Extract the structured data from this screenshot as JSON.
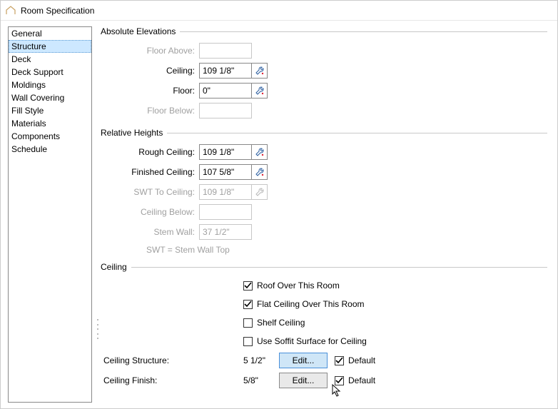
{
  "window": {
    "title": "Room Specification"
  },
  "nav": {
    "items": [
      "General",
      "Structure",
      "Deck",
      "Deck Support",
      "Moldings",
      "Wall Covering",
      "Fill Style",
      "Materials",
      "Components",
      "Schedule"
    ],
    "selected": 1
  },
  "groups": {
    "absolute": {
      "legend": "Absolute Elevations",
      "floor_above_label": "Floor Above:",
      "floor_above_value": "",
      "ceiling_label": "Ceiling:",
      "ceiling_value": "109 1/8\"",
      "floor_label": "Floor:",
      "floor_value": "0\"",
      "floor_below_label": "Floor Below:",
      "floor_below_value": ""
    },
    "relative": {
      "legend": "Relative Heights",
      "rough_ceiling_label": "Rough Ceiling:",
      "rough_ceiling_value": "109 1/8\"",
      "finished_ceiling_label": "Finished Ceiling:",
      "finished_ceiling_value": "107 5/8\"",
      "swt_to_ceiling_label": "SWT To Ceiling:",
      "swt_to_ceiling_value": "109 1/8\"",
      "ceiling_below_label": "Ceiling Below:",
      "ceiling_below_value": "",
      "stem_wall_label": "Stem Wall:",
      "stem_wall_value": "37 1/2\"",
      "note": "SWT = Stem Wall Top"
    },
    "ceiling": {
      "legend": "Ceiling",
      "roof_over_label": "Roof Over This Room",
      "roof_over_checked": true,
      "flat_ceiling_label": "Flat Ceiling Over This Room",
      "flat_ceiling_checked": true,
      "shelf_ceiling_label": "Shelf Ceiling",
      "shelf_ceiling_checked": false,
      "soffit_label": "Use Soffit Surface for Ceiling",
      "soffit_checked": false,
      "structure_label": "Ceiling Structure:",
      "structure_value": "5 1/2\"",
      "structure_edit": "Edit...",
      "structure_default_label": "Default",
      "structure_default_checked": true,
      "finish_label": "Ceiling Finish:",
      "finish_value": "5/8\"",
      "finish_edit": "Edit...",
      "finish_default_label": "Default",
      "finish_default_checked": true
    }
  }
}
